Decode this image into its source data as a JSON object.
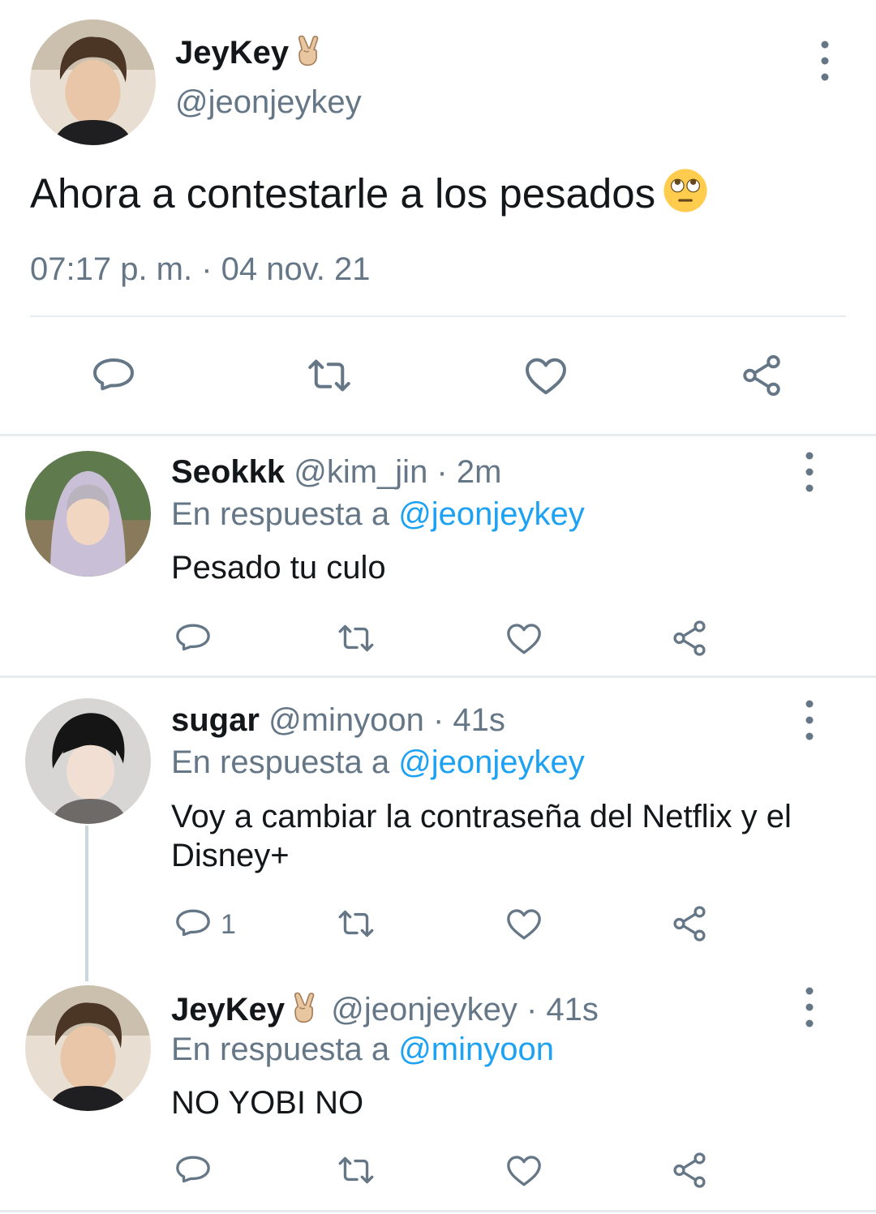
{
  "main_tweet": {
    "author_name": "JeyKey",
    "author_emoji": "victory-hand-icon",
    "handle": "@jeonjeykey",
    "text": "Ahora a contestarle a los pesados",
    "text_emoji": "face-with-rolling-eyes-icon",
    "timestamp": "07:17 p. m. · 04 nov. 21"
  },
  "replies": [
    {
      "name": "Seokkk",
      "handle_time": "@kim_jin · 2m",
      "reply_prefix": "En respuesta a",
      "reply_to": "@jeonjeykey",
      "text": "Pesado tu culo",
      "reply_count": ""
    },
    {
      "name": "sugar",
      "handle_time": "@minyoon · 41s",
      "reply_prefix": "En respuesta a",
      "reply_to": "@jeonjeykey",
      "text": "Voy a cambiar la contraseña del Netflix y el Disney+",
      "reply_count": "1"
    },
    {
      "name": "JeyKey",
      "name_emoji": "victory-hand-icon",
      "handle_time": "@jeonjeykey · 41s",
      "reply_prefix": "En respuesta a",
      "reply_to": "@minyoon",
      "text": "NO YOBI NO",
      "reply_count": ""
    }
  ],
  "colors": {
    "text": "#14171a",
    "secondary": "#657786",
    "link": "#1da1f2",
    "divider": "#e6ecf0"
  }
}
